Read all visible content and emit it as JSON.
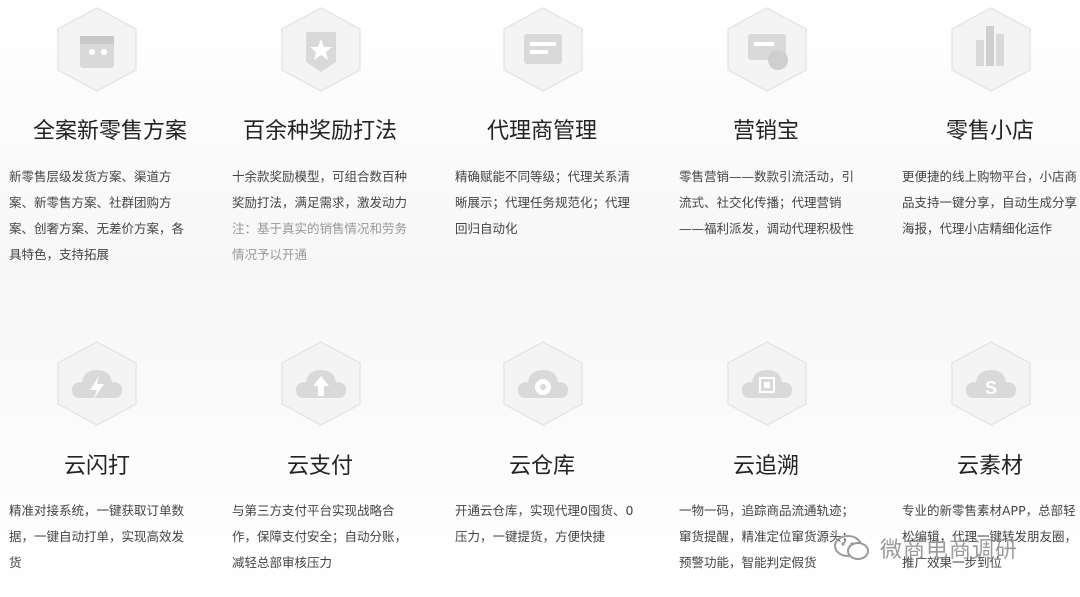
{
  "row1": [
    {
      "icon": "gift-box-icon",
      "title": "全案新零售方案",
      "desc": "新零售层级发货方案、渠道方案、新零售方案、社群团购方案、创奢方案、无差价方案，各具特色，支持拓展",
      "note": ""
    },
    {
      "icon": "star-shield-icon",
      "title": "百余种奖励打法",
      "desc": "十余款奖励模型，可组合数百种奖励打法，满足需求，激发动力",
      "note": "注：基于真实的销售情况和劳务情况予以开通"
    },
    {
      "icon": "agent-management-icon",
      "title": "代理商管理",
      "desc": "精确赋能不同等级；代理关系清晰展示；代理任务规范化；代理回归自动化",
      "note": ""
    },
    {
      "icon": "marketing-card-icon",
      "title": "营销宝",
      "desc": "零售营销——数款引流活动，引流式、社交化传播；代理营销——福利派发，调动代理积极性",
      "note": ""
    },
    {
      "icon": "retail-store-icon",
      "title": "零售小店",
      "desc": "更便捷的线上购物平台，小店商品支持一键分享，自动生成分享海报，代理小店精细化运作",
      "note": ""
    }
  ],
  "row2": [
    {
      "icon": "cloud-lightning-icon",
      "title": "云闪打",
      "desc": "精准对接系统，一键获取订单数据，一键自动打单，实现高效发货"
    },
    {
      "icon": "cloud-payment-icon",
      "title": "云支付",
      "desc": "与第三方支付平台实现战略合作，保障支付安全；自动分账，减轻总部审核压力"
    },
    {
      "icon": "cloud-warehouse-icon",
      "title": "云仓库",
      "desc": "开通云仓库，实现代理0囤货、0压力，一键提货，方便快捷"
    },
    {
      "icon": "cloud-trace-icon",
      "title": "云追溯",
      "desc": "一物一码，追踪商品流通轨迹；窜货提醒，精准定位窜货源头；预警功能，智能判定假货"
    },
    {
      "icon": "cloud-material-icon",
      "title": "云素材",
      "desc": "专业的新零售素材APP，总部轻松编辑，代理一键转发朋友圈，推广效果一步到位"
    }
  ],
  "watermark": {
    "icon": "wechat-icon",
    "text": "微商电商调研"
  },
  "colors": {
    "title": "#222222",
    "text": "#444444",
    "note": "#999999",
    "icon": "#cfcfcf"
  }
}
